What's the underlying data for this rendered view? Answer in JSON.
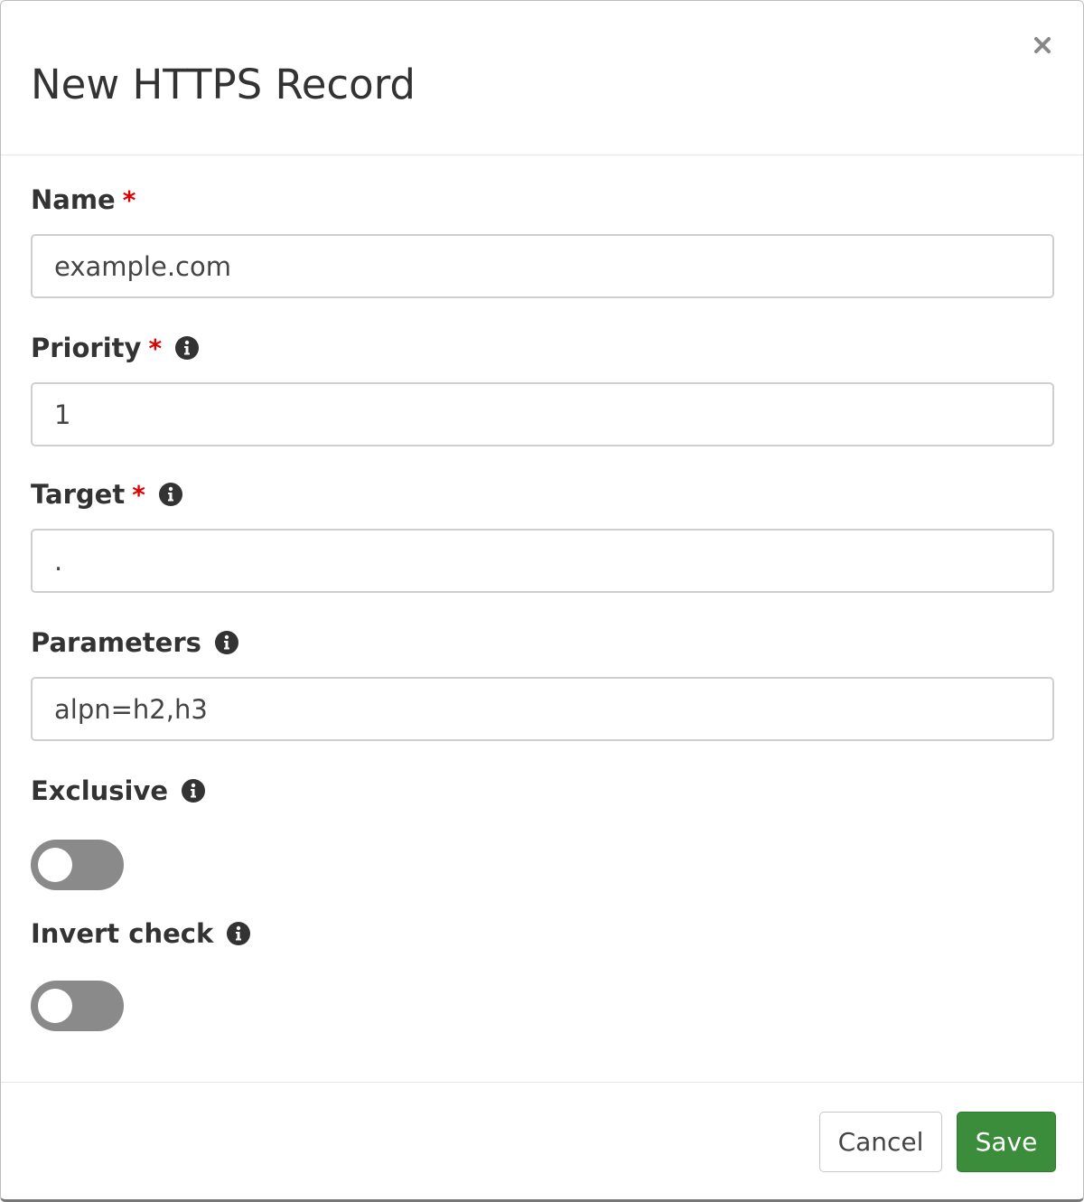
{
  "dialog": {
    "title": "New HTTPS Record",
    "close_label": "×"
  },
  "fields": {
    "name": {
      "label": "Name",
      "required_mark": "*",
      "value": "example.com"
    },
    "priority": {
      "label": "Priority",
      "required_mark": "*",
      "value": "1"
    },
    "target": {
      "label": "Target",
      "required_mark": "*",
      "value": "."
    },
    "parameters": {
      "label": "Parameters",
      "value": "alpn=h2,h3"
    },
    "exclusive": {
      "label": "Exclusive",
      "checked": false
    },
    "invert_check": {
      "label": "Invert check",
      "checked": false
    }
  },
  "footer": {
    "cancel_label": "Cancel",
    "save_label": "Save"
  },
  "colors": {
    "required": "#e00000",
    "save_button": "#3b8d3c",
    "toggle_off": "#8a8a8a"
  },
  "icons": {
    "close": "close-icon",
    "info": "info-icon"
  }
}
